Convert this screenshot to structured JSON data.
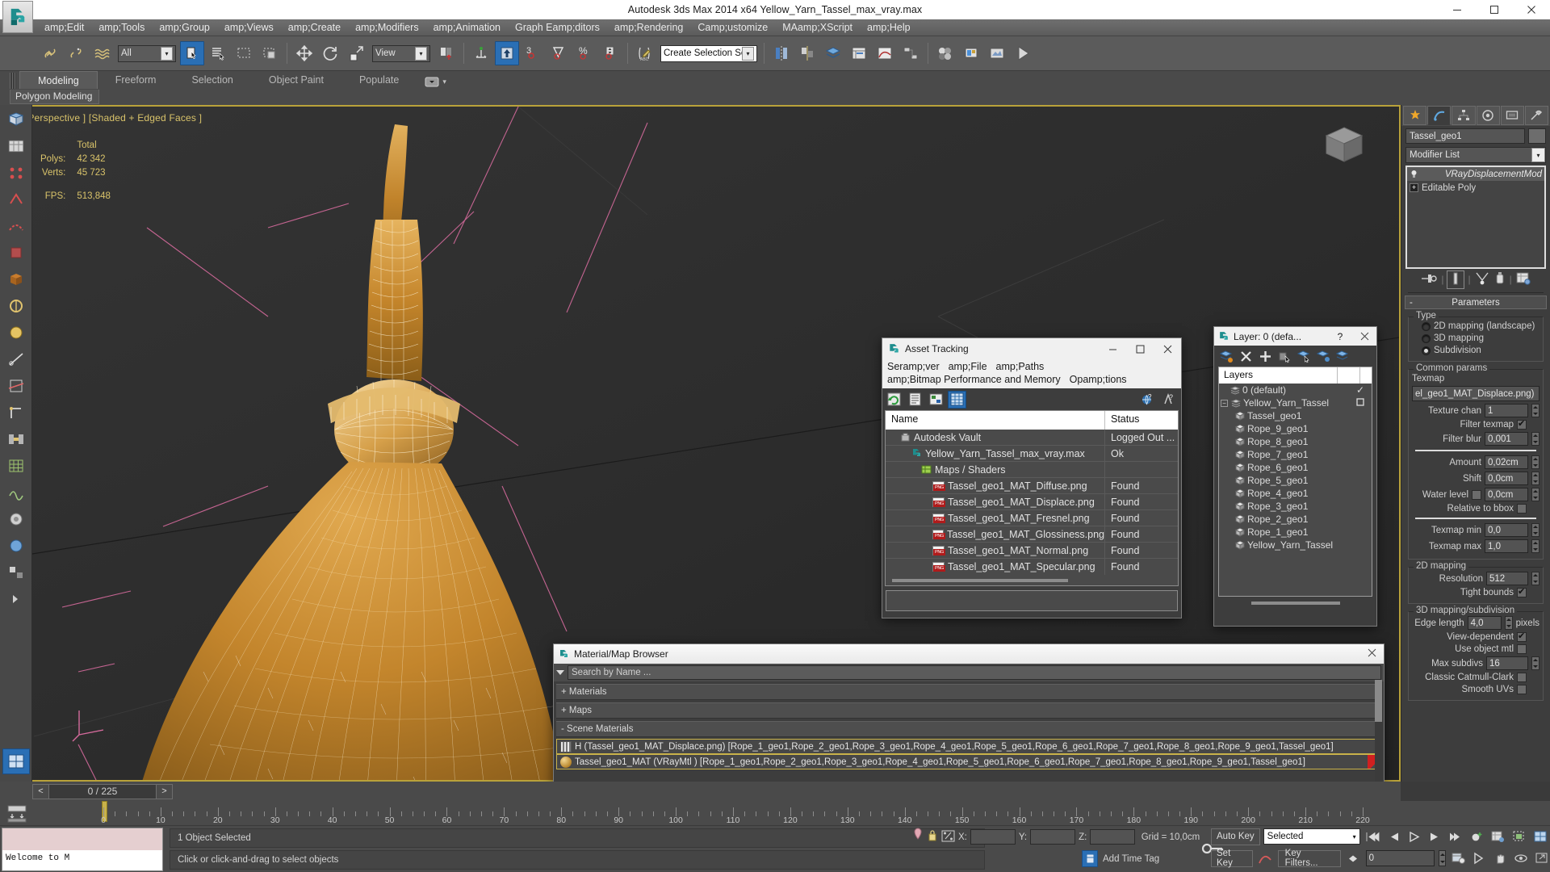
{
  "window": {
    "title": "Autodesk 3ds Max  2014 x64     Yellow_Yarn_Tassel_max_vray.max",
    "minimize": "—",
    "maximize": "❐",
    "close": "✕"
  },
  "menubar": {
    "items": [
      "amp;Edit",
      "amp;Tools",
      "amp;Group",
      "amp;Views",
      "amp;Create",
      "amp;Modifiers",
      "amp;Animation",
      "Graph Eamp;ditors",
      "amp;Rendering",
      "Camp;ustomize",
      "MAamp;XScript",
      "amp;Help"
    ]
  },
  "toolbar": {
    "selection_filter": "All",
    "reference_coord": "View",
    "named_selection_set": "Create Selection Se",
    "angle_snap_label": "3",
    "percent_label": "%"
  },
  "ribbon": {
    "tabs": [
      "Modeling",
      "Freeform",
      "Selection",
      "Object Paint",
      "Populate"
    ],
    "active_tab": "Modeling",
    "panel_name": "Polygon Modeling"
  },
  "viewport": {
    "label": "[+] [Perspective ] [Shaded + Edged Faces ]",
    "stats_header": "Total",
    "stats": [
      {
        "label": "Polys:",
        "value": "42 342"
      },
      {
        "label": "Verts:",
        "value": "45 723"
      }
    ],
    "fps_label": "FPS:",
    "fps_value": "513,848"
  },
  "command_panel": {
    "object_name": "Tassel_geo1",
    "modifier_list_label": "Modifier List",
    "stack": [
      {
        "label": "VRayDisplacementMod",
        "selected": true
      },
      {
        "label": "Editable Poly",
        "selected": false
      }
    ],
    "rollout_title": "Parameters",
    "rollout_collapse": "-",
    "type_group": "Type",
    "type_options": [
      {
        "label": "2D mapping (landscape)",
        "checked": false
      },
      {
        "label": "3D mapping",
        "checked": false
      },
      {
        "label": "Subdivision",
        "checked": true
      }
    ],
    "common_group": "Common params",
    "texmap_label": "Texmap",
    "texmap_value": "el_geo1_MAT_Displace.png)",
    "fields": [
      {
        "label": "Texture chan",
        "value": "1"
      },
      {
        "label": "Filter blur",
        "value": "0,001"
      },
      {
        "label": "Amount",
        "value": "0,02cm"
      },
      {
        "label": "Shift",
        "value": "0,0cm"
      },
      {
        "label": "Water level",
        "value": "0,0cm"
      },
      {
        "label": "Texmap min",
        "value": "0,0"
      },
      {
        "label": "Texmap max",
        "value": "1,0"
      }
    ],
    "filter_texmap_label": "Filter texmap",
    "filter_texmap_checked": true,
    "water_level_checked": false,
    "relative_bbox_label": "Relative to bbox",
    "relative_bbox_checked": false,
    "mapping2d_group": "2D mapping",
    "resolution_label": "Resolution",
    "resolution_value": "512",
    "tight_bounds_label": "Tight bounds",
    "tight_bounds_checked": true,
    "mapping3d_group": "3D mapping/subdivision",
    "edge_length_label": "Edge length",
    "edge_length_value": "4,0",
    "edge_length_units": "pixels",
    "view_dependent_label": "View-dependent",
    "view_dependent_checked": true,
    "use_object_mtl_label": "Use object mtl",
    "use_object_mtl_checked": false,
    "max_subdivs_label": "Max subdivs",
    "max_subdivs_value": "16",
    "catmull_label": "Classic Catmull-Clark",
    "catmull_checked": false,
    "smooth_uvs_label": "Smooth UVs",
    "smooth_uvs_checked": false
  },
  "asset_tracking": {
    "title": "Asset Tracking",
    "minimize": "—",
    "maximize": "❐",
    "close": "✕",
    "menu_row1": [
      "Seramp;ver",
      "amp;File",
      "amp;Paths"
    ],
    "menu_row2": [
      "amp;Bitmap Performance and Memory",
      "Opamp;tions"
    ],
    "columns": [
      "Name",
      "Status"
    ],
    "rows": [
      {
        "name": "Autodesk Vault",
        "status": "Logged Out ...",
        "indent": 0,
        "icon": "vault-icon"
      },
      {
        "name": "Yellow_Yarn_Tassel_max_vray.max",
        "status": "Ok",
        "indent": 1,
        "icon": "max-file-icon"
      },
      {
        "name": "Maps / Shaders",
        "status": "",
        "indent": 2,
        "icon": "maps-icon"
      },
      {
        "name": "Tassel_geo1_MAT_Diffuse.png",
        "status": "Found",
        "indent": 3,
        "icon": "png-icon"
      },
      {
        "name": "Tassel_geo1_MAT_Displace.png",
        "status": "Found",
        "indent": 3,
        "icon": "png-icon"
      },
      {
        "name": "Tassel_geo1_MAT_Fresnel.png",
        "status": "Found",
        "indent": 3,
        "icon": "png-icon"
      },
      {
        "name": "Tassel_geo1_MAT_Glossiness.png",
        "status": "Found",
        "indent": 3,
        "icon": "png-icon"
      },
      {
        "name": "Tassel_geo1_MAT_Normal.png",
        "status": "Found",
        "indent": 3,
        "icon": "png-icon"
      },
      {
        "name": "Tassel_geo1_MAT_Specular.png",
        "status": "Found",
        "indent": 3,
        "icon": "png-icon"
      }
    ]
  },
  "layer_dialog": {
    "title": "Layer: 0 (defa...",
    "help": "?",
    "close": "✕",
    "column": "Layers",
    "rows": [
      {
        "label": "0 (default)",
        "indent": 1,
        "icon": "layer-icon",
        "mark": "✓",
        "expandable": false
      },
      {
        "label": "Yellow_Yarn_Tassel",
        "indent": 0,
        "icon": "layer-icon",
        "mark": "box",
        "expandable": true
      },
      {
        "label": "Tassel_geo1",
        "indent": 2,
        "icon": "object-icon",
        "mark": "",
        "expandable": false
      },
      {
        "label": "Rope_9_geo1",
        "indent": 2,
        "icon": "object-icon",
        "mark": "",
        "expandable": false
      },
      {
        "label": "Rope_8_geo1",
        "indent": 2,
        "icon": "object-icon",
        "mark": "",
        "expandable": false
      },
      {
        "label": "Rope_7_geo1",
        "indent": 2,
        "icon": "object-icon",
        "mark": "",
        "expandable": false
      },
      {
        "label": "Rope_6_geo1",
        "indent": 2,
        "icon": "object-icon",
        "mark": "",
        "expandable": false
      },
      {
        "label": "Rope_5_geo1",
        "indent": 2,
        "icon": "object-icon",
        "mark": "",
        "expandable": false
      },
      {
        "label": "Rope_4_geo1",
        "indent": 2,
        "icon": "object-icon",
        "mark": "",
        "expandable": false
      },
      {
        "label": "Rope_3_geo1",
        "indent": 2,
        "icon": "object-icon",
        "mark": "",
        "expandable": false
      },
      {
        "label": "Rope_2_geo1",
        "indent": 2,
        "icon": "object-icon",
        "mark": "",
        "expandable": false
      },
      {
        "label": "Rope_1_geo1",
        "indent": 2,
        "icon": "object-icon",
        "mark": "",
        "expandable": false
      },
      {
        "label": "Yellow_Yarn_Tassel",
        "indent": 2,
        "icon": "object-icon",
        "mark": "",
        "expandable": false
      }
    ]
  },
  "material_browser": {
    "title": "Material/Map Browser",
    "close": "✕",
    "search_placeholder": "Search by Name ...",
    "groups": [
      {
        "label": "+ Materials",
        "expanded": false
      },
      {
        "label": "+ Maps",
        "expanded": false
      },
      {
        "label": "- Scene Materials",
        "expanded": true
      }
    ],
    "items": [
      {
        "label": "H (Tassel_geo1_MAT_Displace.png) [Rope_1_geo1,Rope_2_geo1,Rope_3_geo1,Rope_4_geo1,Rope_5_geo1,Rope_6_geo1,Rope_7_geo1,Rope_8_geo1,Rope_9_geo1,Tassel_geo1]",
        "swatch": "hatch"
      },
      {
        "label": "Tassel_geo1_MAT (VRayMtl ) [Rope_1_geo1,Rope_2_geo1,Rope_3_geo1,Rope_4_geo1,Rope_5_geo1,Rope_6_geo1,Rope_7_geo1,Rope_8_geo1,Rope_9_geo1,Tassel_geo1]",
        "swatch": "ball"
      }
    ]
  },
  "time_slider": {
    "frame_text": "0 / 225",
    "prev": "<",
    "next": ">",
    "ticks": [
      "0",
      "10",
      "20",
      "30",
      "40",
      "50",
      "60",
      "70",
      "80",
      "90",
      "100",
      "110",
      "120",
      "130",
      "140",
      "150",
      "160",
      "170",
      "180",
      "190",
      "200",
      "210",
      "220"
    ]
  },
  "status_bar": {
    "listener_text": "Welcome to M",
    "selection_status": "1 Object Selected",
    "prompt": "Click or click-and-drag to select objects",
    "axis_labels": {
      "x": "X:",
      "y": "Y:",
      "z": "Z:"
    },
    "axis_values": {
      "x": "",
      "y": "",
      "z": ""
    },
    "grid": "Grid = 10,0cm",
    "add_time_tag": "Add Time Tag",
    "auto_key": "Auto Key",
    "set_key": "Set Key",
    "key_filters": "Key Filters...",
    "key_mode_selected": "Selected",
    "key_number": "0"
  },
  "colors": {
    "accent_blue": "#2a6fb5",
    "viewport_border": "#b9a23a",
    "viewport_bg": "#2e2e2e",
    "panel_bg": "#3d3d3d",
    "toolbar_bg": "#5b5b5b",
    "text": "#d8d8d8",
    "stat_yellow": "#d9c36a",
    "model_orange": "#c88a2e"
  }
}
